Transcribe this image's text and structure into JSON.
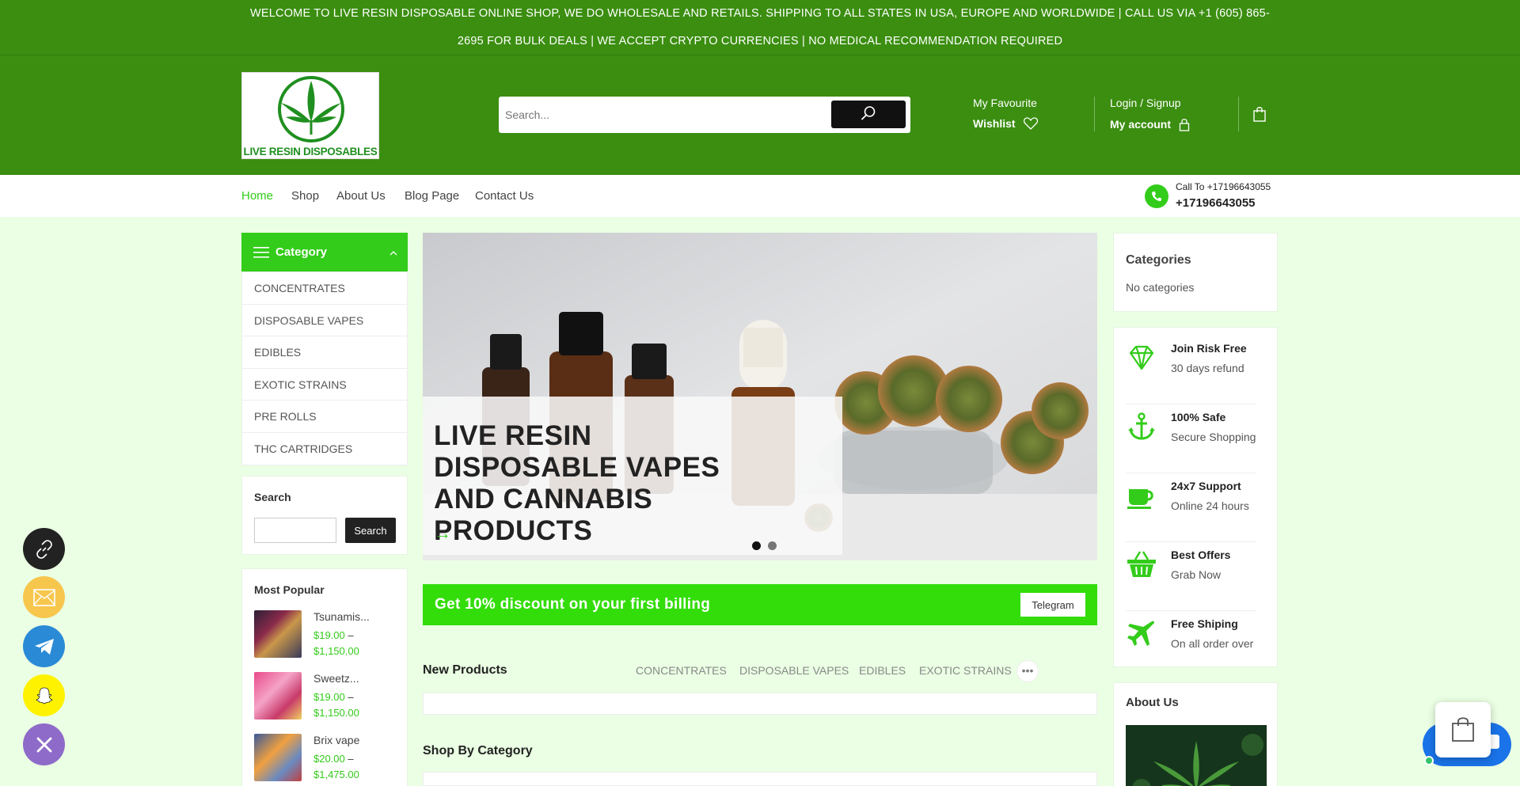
{
  "announcement": "WELCOME TO LIVE RESIN DISPOSABLE ONLINE SHOP, WE DO WHOLESALE AND RETAILS. SHIPPING TO ALL STATES IN USA, EUROPE AND WORLDWIDE | CALL US VIA +1 (605) 865-2695 FOR BULK DEALS | WE ACCEPT CRYPTO CURRENCIES | NO MEDICAL RECOMMENDATION REQUIRED",
  "logo_text": "LIVE RESIN DISPOSABLES",
  "search": {
    "placeholder": "Search..."
  },
  "wishlist": {
    "small": "My Favourite",
    "big": "Wishlist"
  },
  "account": {
    "small": "Login / Signup",
    "big": "My account"
  },
  "nav": {
    "items": [
      "Home",
      "Shop",
      "About Us",
      "Blog Page",
      "Contact Us"
    ],
    "active": "Home"
  },
  "call": {
    "label": "Call To +17196643055",
    "number": "+17196643055"
  },
  "category": {
    "title": "Category",
    "items": [
      "CONCENTRATES",
      "DISPOSABLE VAPES",
      "EDIBLES",
      "EXOTIC STRAINS",
      "PRE ROLLS",
      "THC CARTRIDGES"
    ]
  },
  "sidebar_search": {
    "title": "Search",
    "button": "Search"
  },
  "most_popular": {
    "title": "Most Popular",
    "items": [
      {
        "name": "Tsunamis...",
        "price_from": "$19.00",
        "dash": "–",
        "price_to": "$1,150.00"
      },
      {
        "name": "Sweetz...",
        "price_from": "$19.00",
        "dash": "–",
        "price_to": "$1,150.00"
      },
      {
        "name": "Brix vape",
        "price_from": "$20.00",
        "dash": "–",
        "price_to": "$1,475.00"
      }
    ]
  },
  "slider": {
    "heading": "LIVE RESIN DISPOSABLE VAPES AND CANNABIS PRODUCTS",
    "arrow": "→",
    "slide_count": 2,
    "active_slide": 1
  },
  "promo": {
    "text": "Get 10% discount on your first billing",
    "button": "Telegram"
  },
  "new_products": {
    "title": "New Products",
    "tabs": [
      "CONCENTRATES",
      "DISPOSABLE VAPES",
      "EDIBLES",
      "EXOTIC STRAINS"
    ],
    "more": "•••"
  },
  "shop_by_category": {
    "title": "Shop By Category"
  },
  "categories_widget": {
    "title": "Categories",
    "empty": "No categories"
  },
  "features": [
    {
      "icon": "diamond-icon",
      "title": "Join Risk Free",
      "subtitle": "30 days refund"
    },
    {
      "icon": "anchor-icon",
      "title": "100% Safe",
      "subtitle": "Secure Shopping"
    },
    {
      "icon": "coffee-cup-icon",
      "title": "24x7 Support",
      "subtitle": "Online 24 hours"
    },
    {
      "icon": "basket-icon",
      "title": "Best Offers",
      "subtitle": "Grab Now"
    },
    {
      "icon": "plane-icon",
      "title": "Free Shiping",
      "subtitle": "On all order over"
    }
  ],
  "about_us": {
    "title": "About Us"
  },
  "colors": {
    "header_green": "#3b8e10",
    "accent_green": "#33cc1a",
    "promo_green": "#33dd0a",
    "page_bg": "#eaffe3"
  }
}
